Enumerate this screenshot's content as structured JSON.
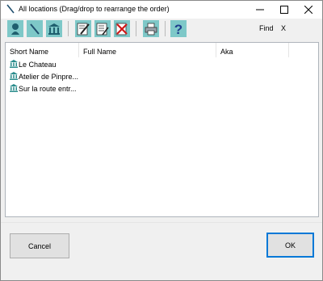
{
  "window": {
    "title": "All locations (Drag/drop to rearrange the order)"
  },
  "toolbar": {
    "buttons": [
      {
        "icon": "person-icon"
      },
      {
        "icon": "pen-icon"
      },
      {
        "icon": "building-icon"
      },
      {
        "icon": "edit-pencil-icon"
      },
      {
        "icon": "edit-list-icon"
      },
      {
        "icon": "delete-icon"
      },
      {
        "icon": "print-icon"
      },
      {
        "icon": "help-icon"
      }
    ],
    "find_label": "Find",
    "find_clear": "X"
  },
  "list": {
    "columns": [
      "Short Name",
      "Full Name",
      "Aka"
    ],
    "rows": [
      {
        "short_name": "Le Chateau",
        "full_name": "",
        "aka": ""
      },
      {
        "short_name": "Atelier de Pinpre...",
        "full_name": "",
        "aka": ""
      },
      {
        "short_name": "Sur la route entr...",
        "full_name": "",
        "aka": ""
      }
    ]
  },
  "footer": {
    "cancel_label": "Cancel",
    "ok_label": "OK"
  },
  "colors": {
    "toolbar_button_bg": "#7ec8c8",
    "ok_border": "#0078d7",
    "location_icon": "#2a8c8c"
  }
}
